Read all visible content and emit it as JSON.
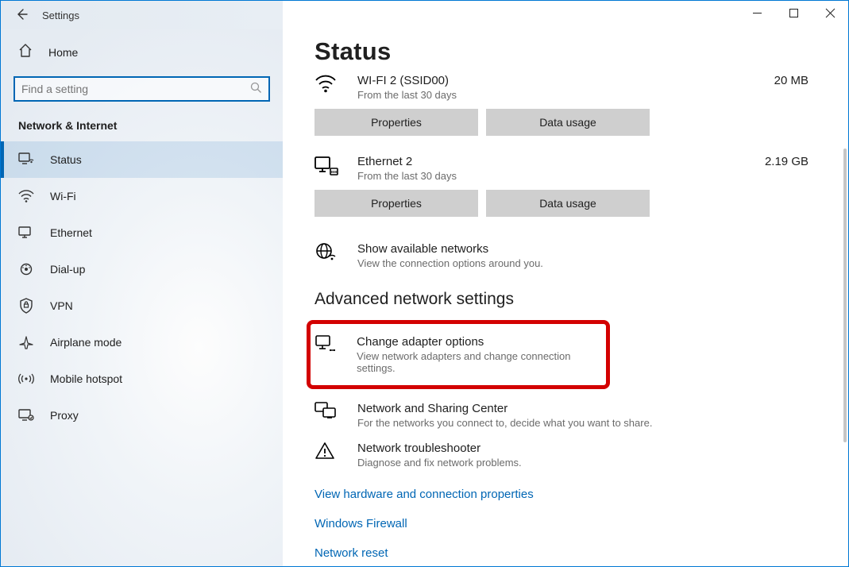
{
  "window": {
    "title": "Settings"
  },
  "sidebar": {
    "home": "Home",
    "search_placeholder": "Find a setting",
    "section": "Network & Internet",
    "items": [
      {
        "label": "Status"
      },
      {
        "label": "Wi-Fi"
      },
      {
        "label": "Ethernet"
      },
      {
        "label": "Dial-up"
      },
      {
        "label": "VPN"
      },
      {
        "label": "Airplane mode"
      },
      {
        "label": "Mobile hotspot"
      },
      {
        "label": "Proxy"
      }
    ]
  },
  "main": {
    "heading": "Status",
    "connections": [
      {
        "name": "WI-FI 2 (SSID00)",
        "sub": "From the last 30 days",
        "usage": "20 MB",
        "b1": "Properties",
        "b2": "Data usage"
      },
      {
        "name": "Ethernet 2",
        "sub": "From the last 30 days",
        "usage": "2.19 GB",
        "b1": "Properties",
        "b2": "Data usage"
      }
    ],
    "show_networks": {
      "title": "Show available networks",
      "desc": "View the connection options around you."
    },
    "advanced_heading": "Advanced network settings",
    "adapter": {
      "title": "Change adapter options",
      "desc": "View network adapters and change connection settings."
    },
    "sharing": {
      "title": "Network and Sharing Center",
      "desc": "For the networks you connect to, decide what you want to share."
    },
    "troubleshoot": {
      "title": "Network troubleshooter",
      "desc": "Diagnose and fix network problems."
    },
    "links": [
      "View hardware and connection properties",
      "Windows Firewall",
      "Network reset"
    ]
  }
}
